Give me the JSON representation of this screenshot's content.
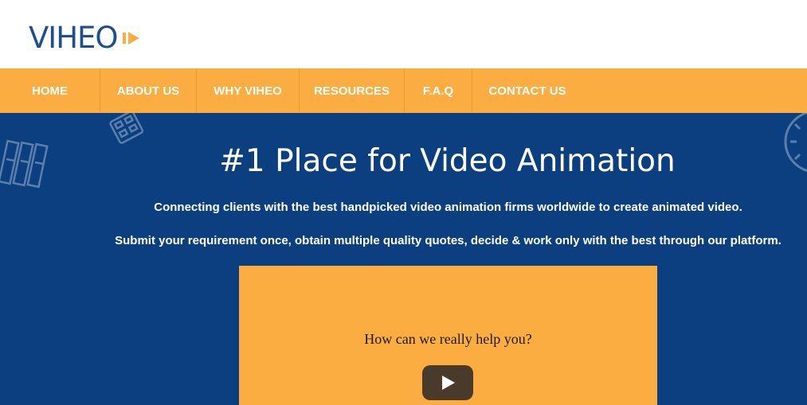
{
  "header": {
    "logo_text": "VIHEO",
    "logo_icon": "play-arrow-icon",
    "brand_color": "#1d4f8f",
    "accent_color": "#fbad42"
  },
  "nav": {
    "items": [
      {
        "label": "HOME"
      },
      {
        "label": "ABOUT US"
      },
      {
        "label": "WHY VIHEO"
      },
      {
        "label": "RESOURCES"
      },
      {
        "label": "F.A.Q"
      },
      {
        "label": "CONTACT US"
      }
    ]
  },
  "hero": {
    "background_color": "#0c3f7f",
    "title": "#1 Place for Video Animation",
    "line1": "Connecting clients with the best handpicked video animation firms worldwide to create animated video.",
    "line2": "Submit your requirement once, obtain multiple quality quotes, decide & work only with the best through our platform."
  },
  "video": {
    "caption": "How can we really help you?",
    "play_icon": "play-icon"
  }
}
